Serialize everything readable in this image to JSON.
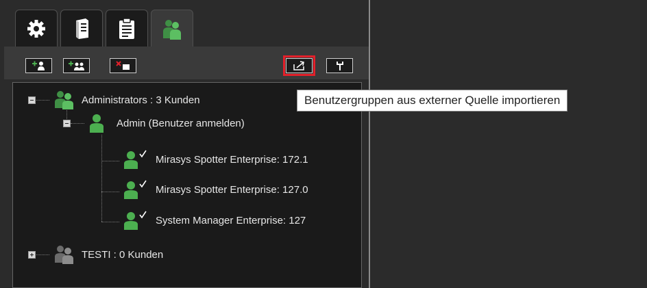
{
  "tabs": [
    {
      "icon": "gear-icon"
    },
    {
      "icon": "server-icon"
    },
    {
      "icon": "clipboard-icon"
    },
    {
      "icon": "user-group-icon",
      "active": true
    }
  ],
  "toolbar": {
    "buttons": [
      {
        "icon": "add-user-icon"
      },
      {
        "icon": "add-group-icon"
      },
      {
        "icon": "remove-user-icon"
      },
      {
        "icon": "import-icon",
        "highlighted": true
      },
      {
        "icon": "wrench-icon"
      }
    ]
  },
  "tree": {
    "nodes": [
      {
        "label": "Administrators : 3 Kunden",
        "icon": "user-group-icon",
        "expander": "minus"
      },
      {
        "label": "Admin (Benutzer anmelden)",
        "icon": "user-icon",
        "expander": "minus"
      },
      {
        "label": "Mirasys Spotter Enterprise: 172.1",
        "icon": "user-check-icon"
      },
      {
        "label": "Mirasys Spotter Enterprise: 127.0",
        "icon": "user-check-icon"
      },
      {
        "label": "System Manager Enterprise: 127",
        "icon": "user-check-icon"
      },
      {
        "label": "TESTI : 0 Kunden",
        "icon": "user-group-gray-icon",
        "expander": "plus"
      }
    ]
  },
  "tooltip": {
    "text": "Benutzergruppen aus externer Quelle importieren"
  },
  "colors": {
    "accent_green": "#4caf50",
    "highlight_red": "#e3202a",
    "panel_bg": "#2b2b2b",
    "tree_bg": "#1a1a1a"
  }
}
